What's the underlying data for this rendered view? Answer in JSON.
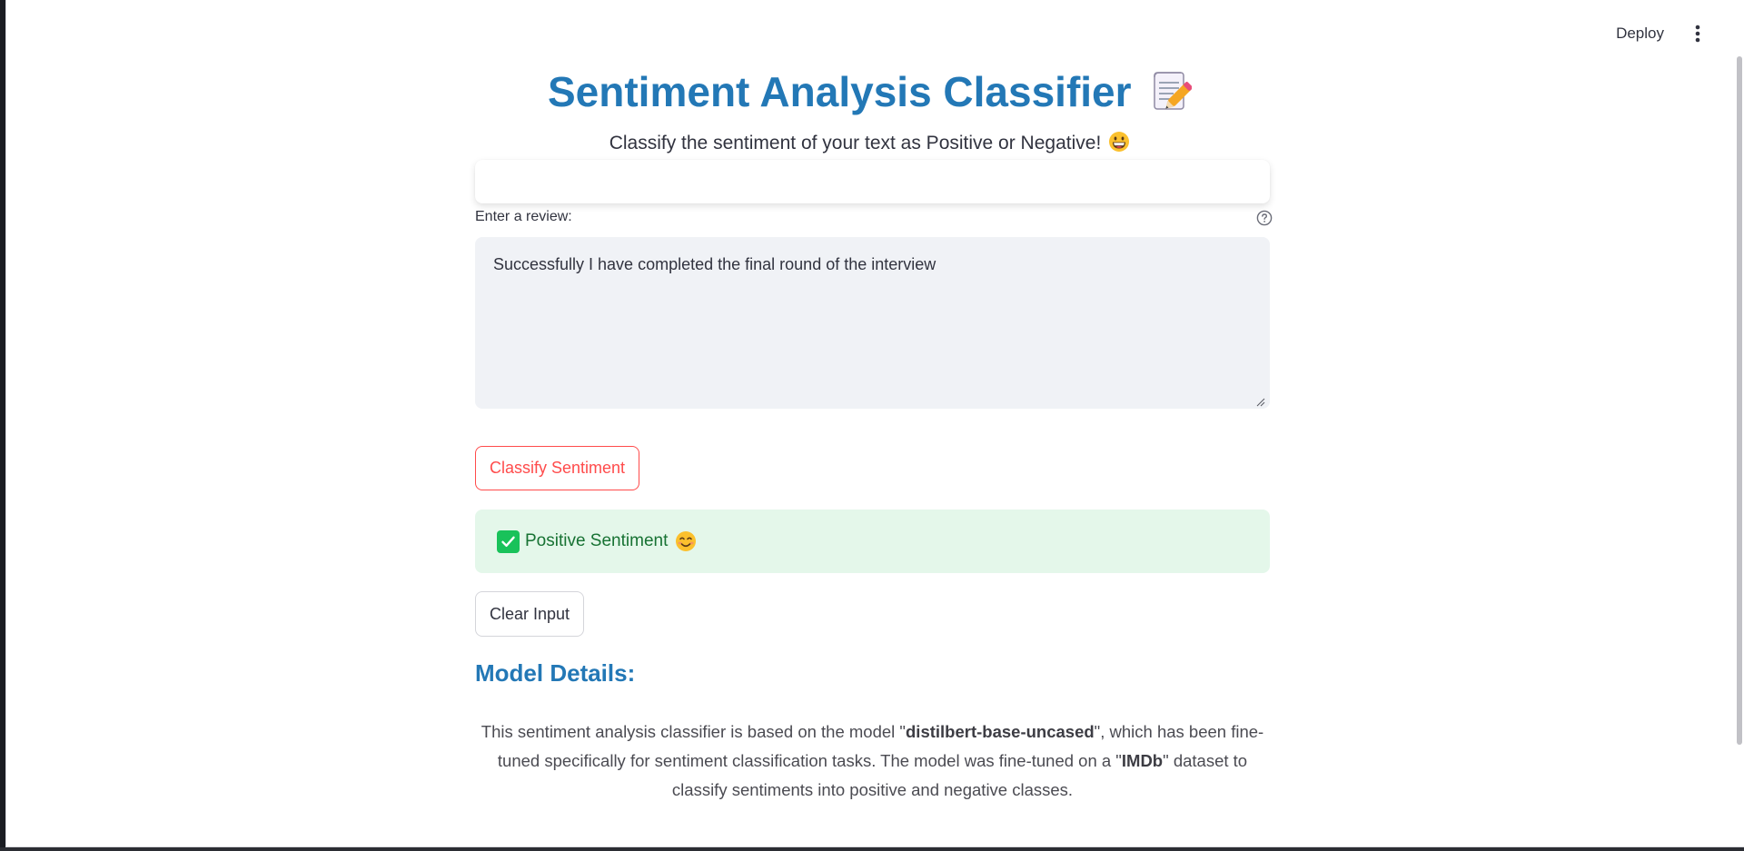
{
  "header": {
    "deploy_label": "Deploy"
  },
  "main": {
    "title": "Sentiment Analysis Classifier",
    "subtitle": "Classify the sentiment of your text as Positive or Negative!",
    "review_field": {
      "label": "Enter a review:",
      "value": "Successfully I have completed the final round of the interview"
    },
    "classify_button_label": "Classify Sentiment",
    "result": {
      "text": "Positive Sentiment"
    },
    "clear_button_label": "Clear Input",
    "model_details": {
      "heading": "Model Details:",
      "text_before_model": "This sentiment analysis classifier is based on the model \"",
      "model_name": "distilbert-base-uncased",
      "text_after_model": "\", which has been fine-tuned specifically for sentiment classification tasks. The model was fine-tuned on a \"",
      "dataset_name": "IMDb",
      "text_after_dataset": "\" dataset to classify sentiments into positive and negative classes."
    }
  },
  "icons": {
    "title_icon": "memo-pencil-icon",
    "subtitle_icon": "grinning-face-icon",
    "result_icon": "smiling-face-icon",
    "check_icon": "check-mark-icon",
    "help_icon": "help-circle-icon",
    "menu_icon": "vertical-dots-icon"
  },
  "colors": {
    "title_blue": "#2378b6",
    "primary_red": "#ff4b4b",
    "success_bg": "#e4f7ea",
    "success_text": "#177233",
    "check_green": "#19c25a",
    "input_bg": "#f0f2f6"
  }
}
